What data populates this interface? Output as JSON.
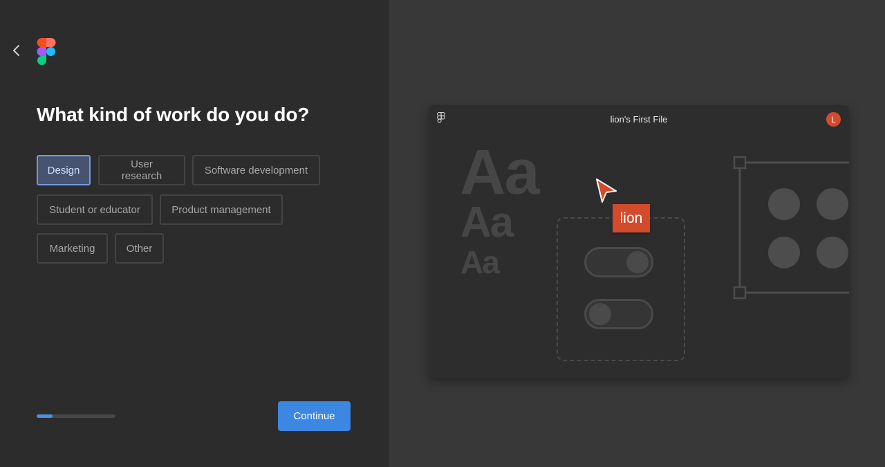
{
  "onboarding": {
    "title": "What kind of work do you do?",
    "options": [
      {
        "label": "Design",
        "selected": true
      },
      {
        "label": "User research",
        "selected": false
      },
      {
        "label": "Software development",
        "selected": false
      },
      {
        "label": "Student or educator",
        "selected": false
      },
      {
        "label": "Product management",
        "selected": false
      },
      {
        "label": "Marketing",
        "selected": false
      },
      {
        "label": "Other",
        "selected": false
      }
    ],
    "continue_label": "Continue",
    "progress_percent": 20
  },
  "preview": {
    "file_title": "lion's First File",
    "avatar_initial": "L",
    "cursor_name": "lion",
    "type_sample": "Aa"
  },
  "colors": {
    "accent": "#3b87e2",
    "selected_chip_bg": "#48536f",
    "selected_chip_border": "#6f99e6",
    "user_color": "#d24b2b",
    "left_panel_bg": "#2c2c2c",
    "right_panel_bg": "#383838"
  },
  "icons": {
    "back": "chevron-left-icon",
    "logo": "figma-logo-icon",
    "cursor": "pointer-cursor-icon"
  }
}
